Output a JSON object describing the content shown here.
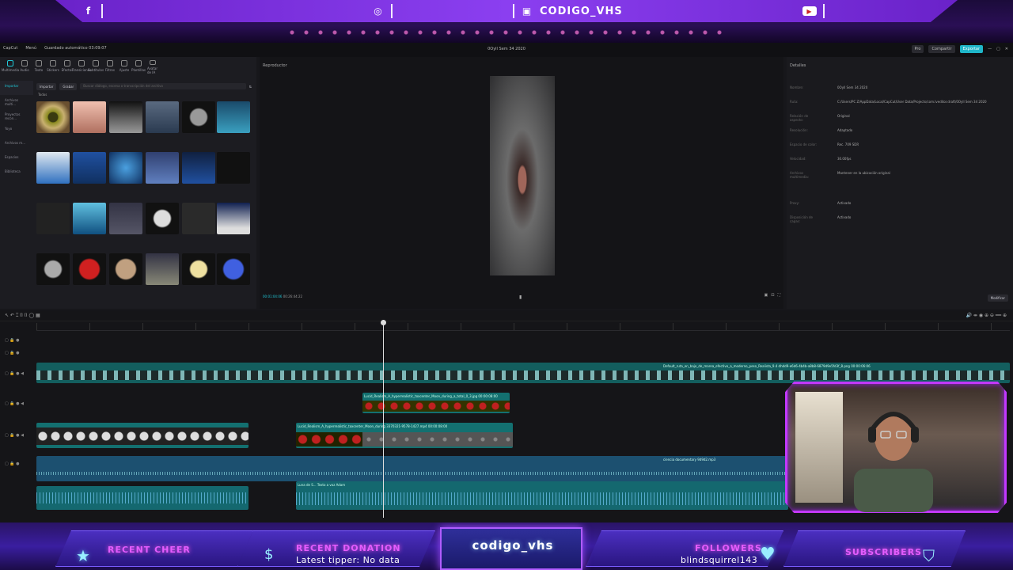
{
  "stream_top": {
    "socials": [
      {
        "icon": "facebook-icon",
        "glyph": "f",
        "label": ""
      },
      {
        "icon": "instagram-icon",
        "glyph": "◎",
        "label": ""
      },
      {
        "icon": "twitch-icon",
        "glyph": "▣",
        "label": "CODIGO_VHS"
      },
      {
        "icon": "youtube-icon",
        "glyph": "▶",
        "label": ""
      }
    ]
  },
  "app": {
    "title": "0Oyll Sem 34 2020",
    "menu": [
      "CapCut",
      "Menú",
      "Guardado automático 03:09:07"
    ],
    "top_right": [
      "Pro",
      "Compartir",
      "Exportar"
    ],
    "tools": [
      "Multimedia",
      "Audio",
      "Texto",
      "Stickers",
      "Efectos",
      "Transiciones",
      "Subtítulos",
      "Filtros",
      "Ajuste",
      "Plantillas",
      "Avatar de IA"
    ],
    "sidebar": [
      "Importar",
      "Archivos multi...",
      "Proyectos recon...",
      "Yoyo",
      "Archivos m...",
      "Espacios",
      "Biblioteca"
    ],
    "import_buttons": [
      "Importar",
      "Grabar"
    ],
    "search_placeholder": "Buscar diálogo, escena o transcripción del archivo",
    "all_label": "Todos",
    "player_label": "Reproductor",
    "timecode_current": "00:01:04:06",
    "timecode_total": "00:26:44:22",
    "details_label": "Detalles",
    "details": [
      {
        "k": "Nombre:",
        "v": "0Oyll Sem 34 2020"
      },
      {
        "k": "Ruta:",
        "v": "C:/Users/PC Z/AppData/Local/CapCut/User Data/Projects/com.lveditor.draft/0Oyll Sem 34 2020"
      },
      {
        "k": "Relación de aspecto:",
        "v": "Original"
      },
      {
        "k": "Resolución:",
        "v": "Adaptado"
      },
      {
        "k": "Espacio de color:",
        "v": "Rec. 709 SDR"
      },
      {
        "k": "Velocidad:",
        "v": "30.00fps"
      },
      {
        "k": "Archivos multimedia:",
        "v": "Mantener en la ubicación original"
      },
      {
        "k": "Proxy:",
        "v": "Activado"
      },
      {
        "k": "Disposición de capas:",
        "v": "Activado"
      }
    ],
    "modify_label": "Modificar",
    "clips": [
      {
        "label": "Default_ruta_en_bajo_de_marea_efectivo_a_moderno_peso_Realista_9.4 dhdd9-e6d6-4b4b-a8b8-6879d9e5fd3f_8.png  00:00:06:06"
      },
      {
        "label": "Lucid_Realism_A_hyperrealistic_toxcenter_Moon_during_a_total_0_3.jpg  00:00:08:00"
      },
      {
        "label": "Lucid_Realism_A_hyperrealistic_toxcenter_Moon_during  3370321-9578-1427.mp4  00:00:08:00"
      },
      {
        "label": "ciencia documentary 9d9d2.mp3"
      },
      {
        "label": "Luna de S... Texto a voz Adam"
      }
    ]
  },
  "stream_bottom": {
    "recent_cheer_title": "RECENT CHEER",
    "recent_donation_title": "RECENT DONATION",
    "recent_donation_value": "Latest tipper: No data",
    "channel": "codigo_vhs",
    "followers_title": "FOLLOWERS",
    "followers_value": "blindsquirrel143",
    "subscribers_title": "SUBSCRIBERS"
  }
}
